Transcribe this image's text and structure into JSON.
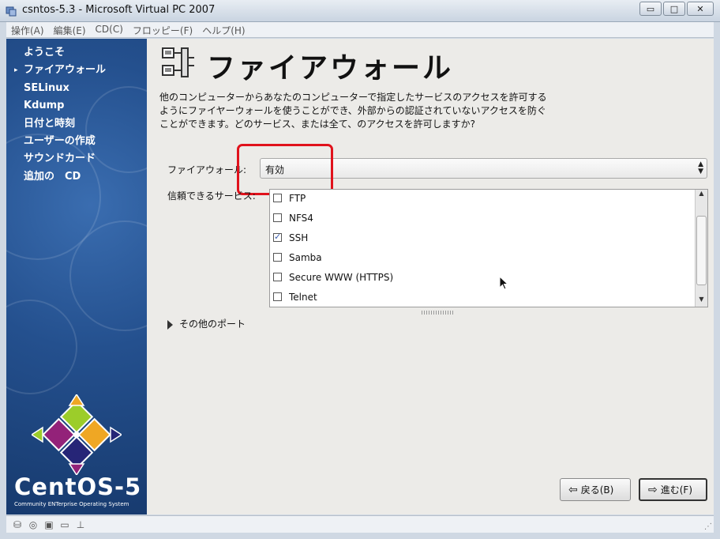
{
  "window": {
    "title": "csntos-5.3 - Microsoft Virtual PC 2007",
    "minimize": "▭",
    "restore": "□",
    "close": "✕"
  },
  "menu": [
    "操作(A)",
    "編集(E)",
    "CD(C)",
    "フロッピー(F)",
    "ヘルプ(H)"
  ],
  "sidebar": {
    "items": [
      {
        "label": "ようこそ",
        "current": false
      },
      {
        "label": "ファイアウォール",
        "current": true
      },
      {
        "label": "SELinux",
        "current": false
      },
      {
        "label": "Kdump",
        "current": false
      },
      {
        "label": "日付と時刻",
        "current": false
      },
      {
        "label": "ユーザーの作成",
        "current": false
      },
      {
        "label": "サウンドカード",
        "current": false
      },
      {
        "label": "追加の　CD",
        "current": false
      }
    ],
    "current_marker": "▸",
    "brand": "CentOS-5",
    "tagline": "Community ENTerprise Operating System"
  },
  "page": {
    "title": "ファイアウォール",
    "description": "他のコンピューターからあなたのコンピューターで指定したサービスのアクセスを許可するようにファイヤーウォールを使うことができ、外部からの認証されていないアクセスを防ぐことができます。どのサービス、または全て、のアクセスを許可しますか?",
    "firewall_label": "ファイアウォール:",
    "firewall_value": "有効",
    "services_label": "信頼できるサービス:",
    "services": [
      {
        "name": "FTP",
        "checked": false
      },
      {
        "name": "NFS4",
        "checked": false
      },
      {
        "name": "SSH",
        "checked": true
      },
      {
        "name": "Samba",
        "checked": false
      },
      {
        "name": "Secure WWW (HTTPS)",
        "checked": false
      },
      {
        "name": "Telnet",
        "checked": false
      }
    ],
    "services_scroll_fraction": 0.6,
    "other_ports": "その他のポート",
    "back_button": "戻る(B)",
    "next_button": "進む(F)"
  },
  "colors": {
    "highlight": "#e0121c",
    "sidebar": "#24508e"
  }
}
